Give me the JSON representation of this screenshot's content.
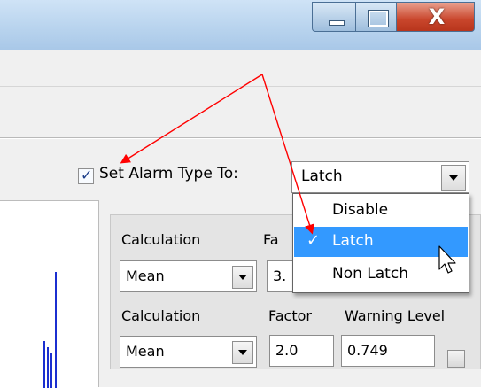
{
  "window": {
    "close_glyph": "X",
    "minimize_icon": "minimize-icon",
    "maximize_icon": "maximize-icon",
    "close_icon": "close-icon"
  },
  "alarm": {
    "checked": true,
    "label": "Set Alarm Type To:",
    "selected": "Latch"
  },
  "dropdown": {
    "options": [
      {
        "label": "Disable",
        "selected": false
      },
      {
        "label": "Latch",
        "selected": true,
        "check": "✓"
      },
      {
        "label": "Non Latch",
        "selected": false
      }
    ],
    "highlight_color": "#3399ff"
  },
  "panel": {
    "row1": {
      "calc_label": "Calculation",
      "calc_value": "Mean",
      "factor_label": "Fa",
      "factor_value": "3."
    },
    "row2": {
      "calc_label": "Calculation",
      "factor_label": "Factor",
      "warning_label": "Warning Level",
      "calc_value": "Mean",
      "factor_value": "2.0",
      "warning_value": "0.749"
    }
  },
  "colors": {
    "arrow": "#ff0000",
    "chart_line": "#1b2fd0",
    "selection": "#3399ff"
  }
}
